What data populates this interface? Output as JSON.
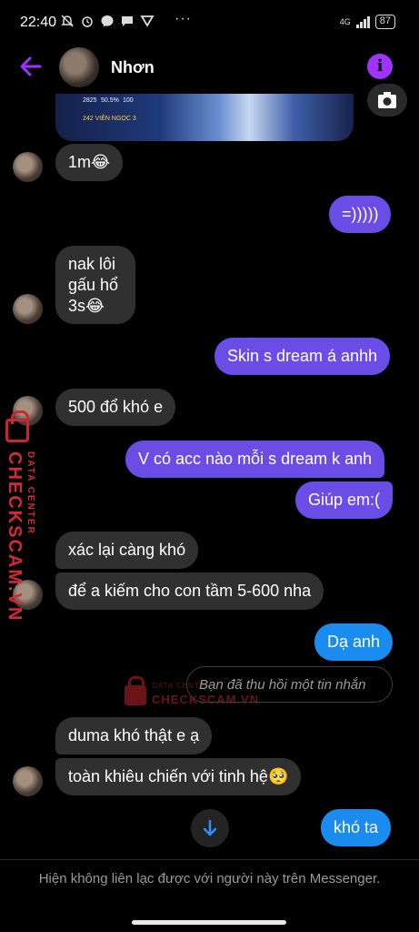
{
  "status_bar": {
    "time": "22:40",
    "network": "4G",
    "battery": "87"
  },
  "header": {
    "contact_name": "Nhơn",
    "back_icon": "arrow-left-icon",
    "info_icon": "info-icon",
    "accent_color": "#a033ff"
  },
  "shared_image": {
    "stats": [
      "2825",
      "50.5%",
      "100"
    ],
    "gems_label": "242 VIÊN NGỌC 3"
  },
  "messages": [
    {
      "side": "in",
      "text": "1m😂"
    },
    {
      "side": "out",
      "text": "=)))))"
    },
    {
      "side": "in",
      "lines": [
        "nak lôi",
        "gấu hổ",
        "3s😂"
      ]
    },
    {
      "side": "out",
      "text": "Skin s dream á anhh"
    },
    {
      "side": "in",
      "text": "500 đổ khó e"
    },
    {
      "side": "out",
      "text": "V có acc nào mỗi s dream k anh"
    },
    {
      "side": "out",
      "text": "Giúp em:("
    },
    {
      "side": "in",
      "text": "xác lại càng khó"
    },
    {
      "side": "in",
      "text": "để a kiếm cho con tầm 5-600 nha"
    },
    {
      "side": "out",
      "text": "Dạ anh"
    },
    {
      "side": "out",
      "text": "Bạn đã thu hồi một tin nhắn",
      "recalled": true
    },
    {
      "side": "in",
      "text": "duma khó thật e ạ"
    },
    {
      "side": "in",
      "text": "toàn khiêu chiến với tinh hệ🥺"
    },
    {
      "side": "out",
      "text": "khó ta"
    }
  ],
  "watermark": {
    "brand": "CHECKSCAM.VN",
    "sub": "DATA CENTER"
  },
  "footer": {
    "notice": "Hiện không liên lạc được với người này trên Messenger."
  },
  "colors": {
    "outgoing_purple": "#6a4ce6",
    "outgoing_blue": "#1a8cf0",
    "incoming_gray": "#303030"
  }
}
